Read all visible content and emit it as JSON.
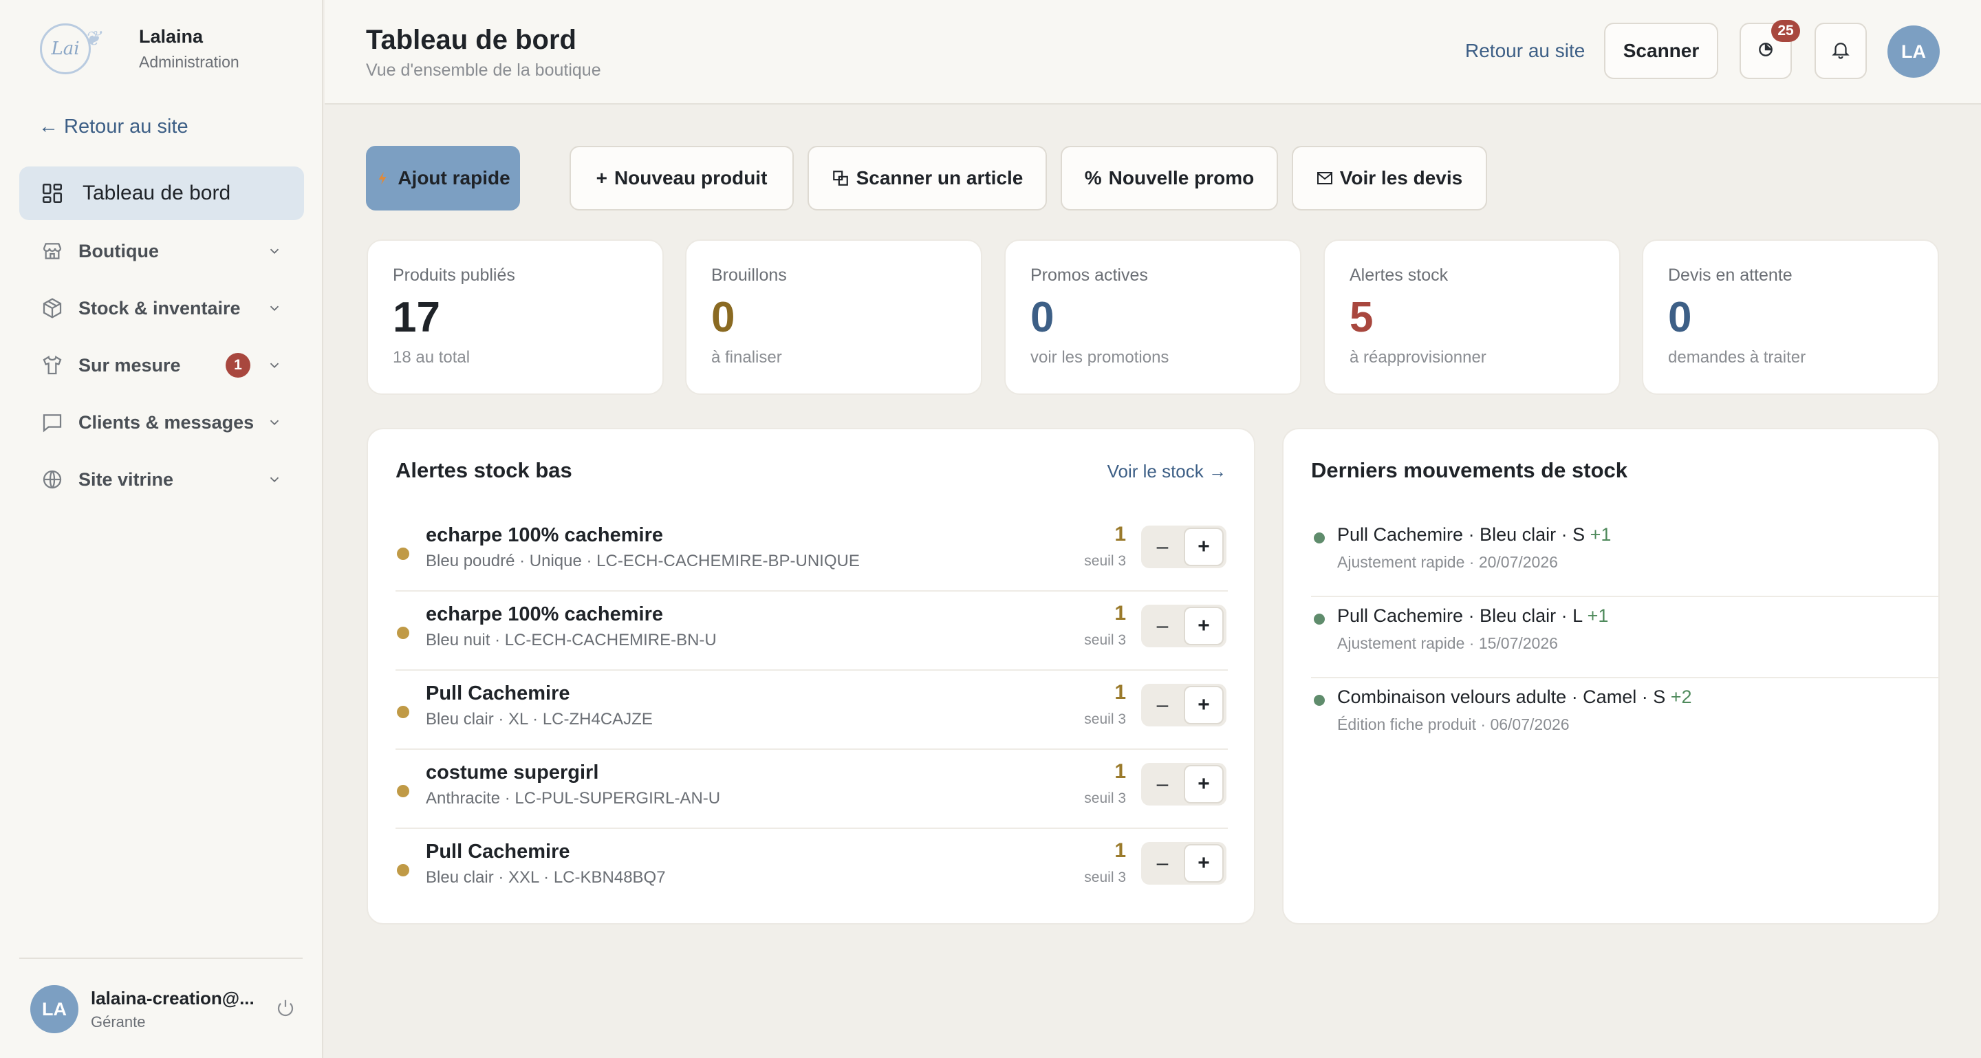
{
  "sidebar": {
    "brand_name": "Lalaina",
    "brand_sub": "Administration",
    "logo_text": "Lai",
    "back_link": "← Retour au site",
    "items": [
      {
        "label": "Tableau de bord",
        "icon": "dashboard-icon",
        "active": true
      },
      {
        "label": "Boutique",
        "icon": "store-icon"
      },
      {
        "label": "Stock & inventaire",
        "icon": "box-icon"
      },
      {
        "label": "Sur mesure",
        "icon": "shirt-icon",
        "badge": "1"
      },
      {
        "label": "Clients & messages",
        "icon": "message-icon"
      },
      {
        "label": "Site vitrine",
        "icon": "globe-icon"
      }
    ],
    "user": {
      "initials": "LA",
      "email": "lalaina-creation@...",
      "role": "Gérante"
    }
  },
  "header": {
    "title": "Tableau de bord",
    "subtitle": "Vue d'ensemble de la boutique",
    "back_link": "Retour au site",
    "scan_label": "Scanner",
    "activity_badge": "25",
    "avatar_initials": "LA"
  },
  "quick_actions": [
    {
      "label": "Ajout rapide",
      "icon": "lightning-icon"
    },
    {
      "label": "Nouveau produit",
      "icon": "plus-icon"
    },
    {
      "label": "Scanner un article",
      "icon": "scan-icon"
    },
    {
      "label": "Nouvelle promo",
      "icon": "percent-icon"
    },
    {
      "label": "Voir les devis",
      "icon": "mail-icon"
    }
  ],
  "stats": [
    {
      "label": "Produits publiés",
      "value": "17",
      "note": "18 au total",
      "color": "#1f2328"
    },
    {
      "label": "Brouillons",
      "value": "0",
      "note": "à finaliser",
      "color": "#8a6a22"
    },
    {
      "label": "Promos actives",
      "value": "0",
      "note": "voir les promotions",
      "color": "#3d5f86"
    },
    {
      "label": "Alertes stock",
      "value": "5",
      "note": "à réapprovisionner",
      "color": "#a8473e"
    },
    {
      "label": "Devis en attente",
      "value": "0",
      "note": "demandes à traiter",
      "color": "#3d5f86"
    }
  ],
  "alerts": {
    "title": "Alertes stock bas",
    "link": "Voir le stock →",
    "rows": [
      {
        "name": "echarpe 100% cachemire",
        "meta": "Bleu poudré · Unique · LC-ECH-CACHEMIRE-BP-UNIQUE",
        "qty": "1",
        "seuil": "seuil 3"
      },
      {
        "name": "echarpe 100% cachemire",
        "meta": "Bleu nuit · LC-ECH-CACHEMIRE-BN-U",
        "qty": "1",
        "seuil": "seuil 3"
      },
      {
        "name": "Pull Cachemire",
        "meta": "Bleu clair · XL · LC-ZH4CAJZE",
        "qty": "1",
        "seuil": "seuil 3"
      },
      {
        "name": "costume supergirl",
        "meta": "Anthracite · LC-PUL-SUPERGIRL-AN-U",
        "qty": "1",
        "seuil": "seuil 3"
      },
      {
        "name": "Pull Cachemire",
        "meta": "Bleu clair · XXL · LC-KBN48BQ7",
        "qty": "1",
        "seuil": "seuil 3"
      }
    ],
    "minus_label": "–",
    "plus_label": "+"
  },
  "movements": {
    "title": "Derniers mouvements de stock",
    "rows": [
      {
        "title": "Pull Cachemire · Bleu clair · S",
        "delta": "+1",
        "meta": "Ajustement rapide · 20/07/2026"
      },
      {
        "title": "Pull Cachemire · Bleu clair · L",
        "delta": "+1",
        "meta": "Ajustement rapide · 15/07/2026"
      },
      {
        "title": "Combinaison velours adulte · Camel · S",
        "delta": "+2",
        "meta": "Édition fiche produit · 06/07/2026"
      }
    ]
  }
}
